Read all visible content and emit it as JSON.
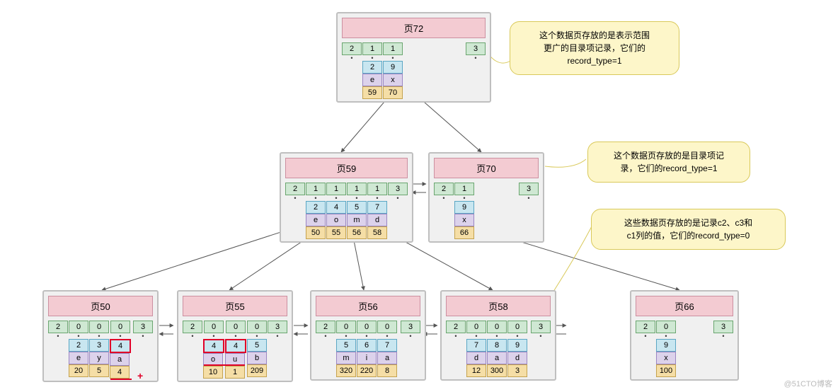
{
  "watermark": "@51CTO博客",
  "callouts": {
    "c1": "这个数据页存放的是表示范围\n更广的目录项记录，它们的\nrecord_type=1",
    "c2": "这个数据页存放的是目录项记\n录，它们的record_type=1",
    "c3": "这些数据页存放的是记录c2、c3和\nc1列的值，它们的record_type=0"
  },
  "pages": {
    "p72": {
      "title": "页72",
      "hdr": [
        "2",
        "1",
        "1"
      ],
      "tail": "3",
      "cols": [
        [
          "2",
          "e",
          "59"
        ],
        [
          "9",
          "x",
          "70"
        ]
      ]
    },
    "p59": {
      "title": "页59",
      "hdr": [
        "2",
        "1",
        "1",
        "1",
        "1"
      ],
      "tail": "3",
      "cols": [
        [
          "2",
          "e",
          "50"
        ],
        [
          "4",
          "o",
          "55"
        ],
        [
          "5",
          "m",
          "56"
        ],
        [
          "7",
          "d",
          "58"
        ]
      ]
    },
    "p70": {
      "title": "页70",
      "hdr": [
        "2",
        "1"
      ],
      "tail": "3",
      "cols": [
        [
          "9",
          "x",
          "66"
        ]
      ]
    },
    "p50": {
      "title": "页50",
      "hdr": [
        "2",
        "0",
        "0",
        "0"
      ],
      "tail": "3",
      "cols": [
        [
          "2",
          "e",
          "20"
        ],
        [
          "3",
          "y",
          "5"
        ],
        [
          "4",
          "a",
          "4"
        ]
      ],
      "plus": "+"
    },
    "p55": {
      "title": "页55",
      "hdr": [
        "2",
        "0",
        "0",
        "0"
      ],
      "tail": "3",
      "cols": [
        [
          "4",
          "o",
          "10"
        ],
        [
          "4",
          "u",
          "1"
        ],
        [
          "5",
          "b",
          "209"
        ]
      ]
    },
    "p56": {
      "title": "页56",
      "hdr": [
        "2",
        "0",
        "0",
        "0"
      ],
      "tail": "3",
      "cols": [
        [
          "5",
          "m",
          "320"
        ],
        [
          "6",
          "i",
          "220"
        ],
        [
          "7",
          "a",
          "8"
        ]
      ]
    },
    "p58": {
      "title": "页58",
      "hdr": [
        "2",
        "0",
        "0",
        "0"
      ],
      "tail": "3",
      "cols": [
        [
          "7",
          "d",
          "12"
        ],
        [
          "8",
          "a",
          "300"
        ],
        [
          "9",
          "d",
          "3"
        ]
      ]
    },
    "p66": {
      "title": "页66",
      "hdr": [
        "2",
        "0"
      ],
      "tail": "3",
      "cols": [
        [
          "9",
          "x",
          "100"
        ]
      ]
    }
  },
  "chart_data": {
    "type": "table",
    "title": "B+ tree index page structure",
    "levels": [
      {
        "level": 0,
        "pages": [
          {
            "page": 72,
            "record_type": 1,
            "entries": [
              {
                "key": 2,
                "c": "e",
                "child": 59
              },
              {
                "key": 9,
                "c": "x",
                "child": 70
              }
            ]
          }
        ]
      },
      {
        "level": 1,
        "pages": [
          {
            "page": 59,
            "record_type": 1,
            "entries": [
              {
                "key": 2,
                "c": "e",
                "child": 50
              },
              {
                "key": 4,
                "c": "o",
                "child": 55
              },
              {
                "key": 5,
                "c": "m",
                "child": 56
              },
              {
                "key": 7,
                "c": "d",
                "child": 58
              }
            ]
          },
          {
            "page": 70,
            "record_type": 1,
            "entries": [
              {
                "key": 9,
                "c": "x",
                "child": 66
              }
            ]
          }
        ]
      },
      {
        "level": 2,
        "pages": [
          {
            "page": 50,
            "record_type": 0,
            "rows": [
              {
                "c2": 2,
                "c3": "e",
                "c1": 20
              },
              {
                "c2": 3,
                "c3": "y",
                "c1": 5
              },
              {
                "c2": 4,
                "c3": "a",
                "c1": 4
              }
            ]
          },
          {
            "page": 55,
            "record_type": 0,
            "rows": [
              {
                "c2": 4,
                "c3": "o",
                "c1": 10
              },
              {
                "c2": 4,
                "c3": "u",
                "c1": 1
              },
              {
                "c2": 5,
                "c3": "b",
                "c1": 209
              }
            ]
          },
          {
            "page": 56,
            "record_type": 0,
            "rows": [
              {
                "c2": 5,
                "c3": "m",
                "c1": 320
              },
              {
                "c2": 6,
                "c3": "i",
                "c1": 220
              },
              {
                "c2": 7,
                "c3": "a",
                "c1": 8
              }
            ]
          },
          {
            "page": 58,
            "record_type": 0,
            "rows": [
              {
                "c2": 7,
                "c3": "d",
                "c1": 12
              },
              {
                "c2": 8,
                "c3": "a",
                "c1": 300
              },
              {
                "c2": 9,
                "c3": "d",
                "c1": 3
              }
            ]
          },
          {
            "page": 66,
            "record_type": 0,
            "rows": [
              {
                "c2": 9,
                "c3": "x",
                "c1": 100
              }
            ]
          }
        ]
      }
    ],
    "sibling_links": [
      [
        59,
        70
      ],
      [
        50,
        55
      ],
      [
        55,
        56
      ],
      [
        56,
        58
      ],
      [
        58,
        66
      ]
    ],
    "highlighted_inserts": {
      "page50": {
        "c2": 4,
        "c3": "a",
        "c1": 4
      },
      "page55": [
        {
          "c2": 4,
          "c3": "o"
        },
        {
          "c2": 4,
          "c3": "u"
        }
      ]
    }
  }
}
